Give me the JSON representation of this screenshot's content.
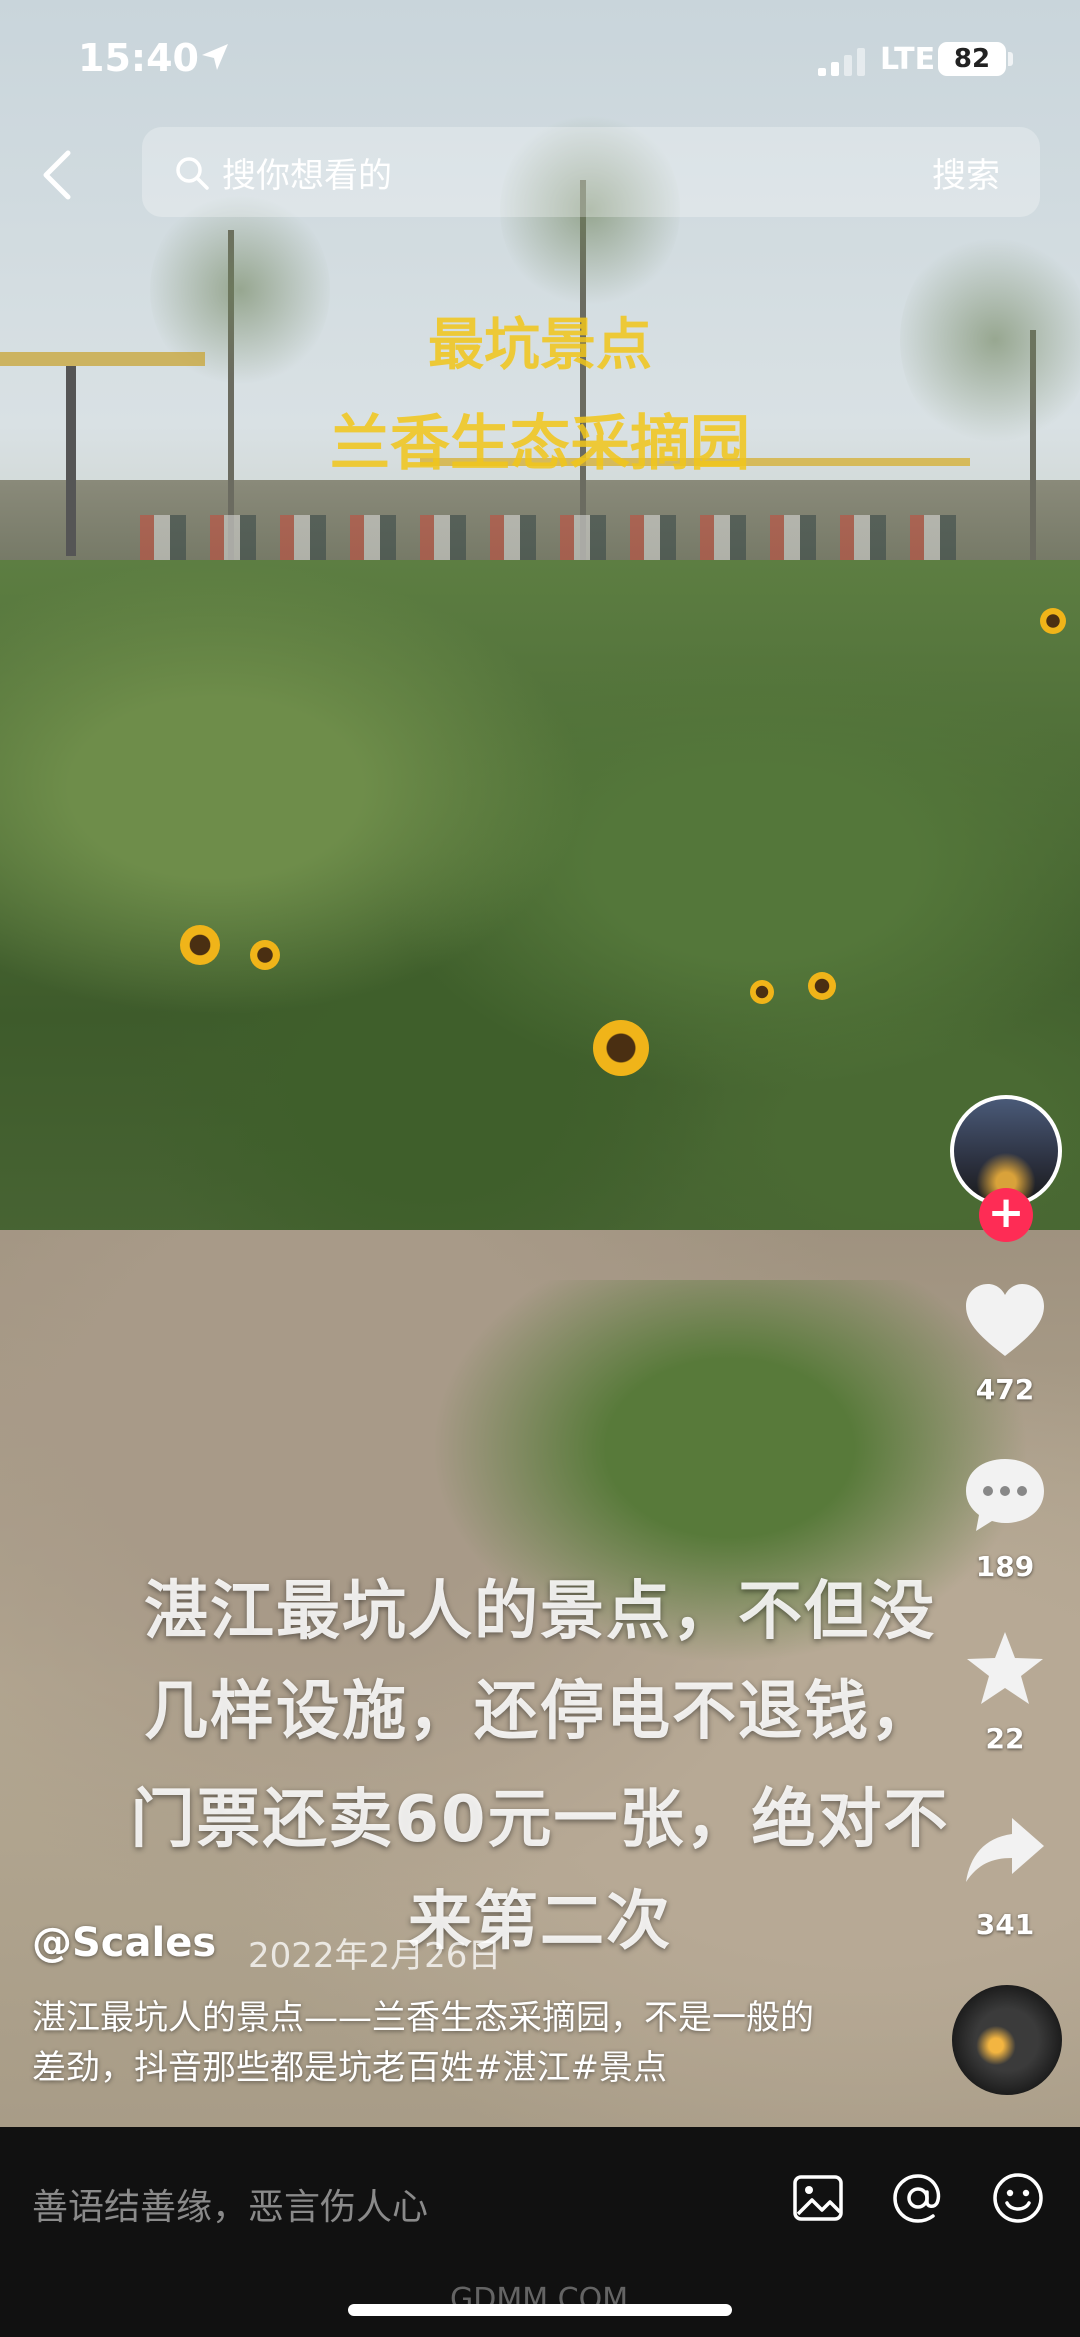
{
  "status_bar": {
    "time": "15:40",
    "network": "LTE",
    "battery": "82"
  },
  "search": {
    "placeholder": "搜你想看的",
    "submit_label": "搜索"
  },
  "scene_sign": {
    "line1": "最坑景点",
    "line2": "兰香生态采摘园"
  },
  "actions": {
    "likes": "472",
    "comments": "189",
    "favorites": "22",
    "shares": "341"
  },
  "overlay": {
    "lines": [
      "湛江最坑人的景点，不但没",
      "几样设施，还停电不退钱，",
      "门票还卖60元一张，绝对不",
      "来第二次"
    ]
  },
  "post": {
    "author": "@Scales",
    "date": "2022年2月26日",
    "description": "湛江最坑人的景点——兰香生态采摘园，不是一般的差劲，抖音那些都是坑老百姓#湛江#景点"
  },
  "comment_bar": {
    "placeholder": "善语结善缘，恶言伤人心"
  },
  "watermark": "GDMM.COM",
  "icons": {
    "back": "chevron-left-icon",
    "search": "search-icon",
    "like": "heart-icon",
    "comment": "comment-bubble-icon",
    "favorite": "star-icon",
    "share": "share-arrow-icon",
    "image": "image-icon",
    "mention": "at-icon",
    "emoji": "emoji-icon"
  },
  "colors": {
    "accent": "#fe2c55",
    "bottom_bar": "#111111"
  }
}
